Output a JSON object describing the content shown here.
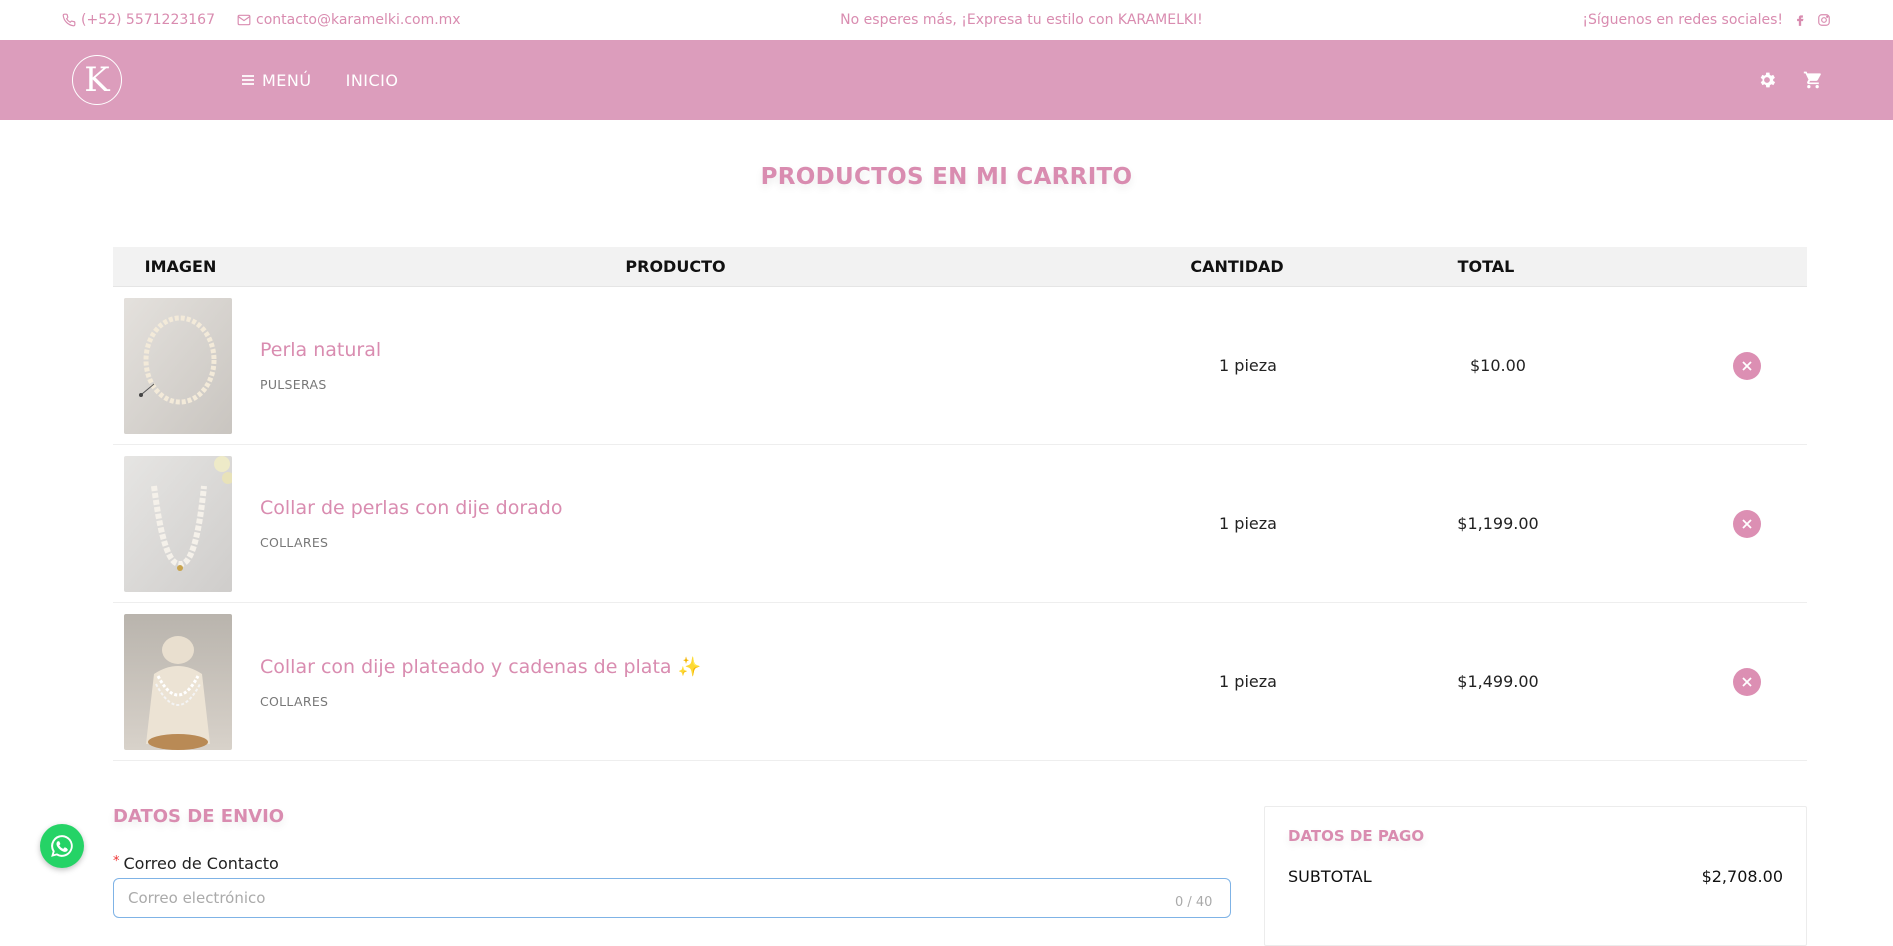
{
  "topbar": {
    "phone": "(+52) 5571223167",
    "email": "contacto@karamelki.com.mx",
    "promo": "No esperes más, ¡Expresa tu estilo con KARAMELKI!",
    "social": "¡Síguenos en redes sociales!"
  },
  "nav": {
    "logo_letter": "K",
    "menu_label": "MENÚ",
    "home_label": "INICIO"
  },
  "page_title": "PRODUCTOS EN MI CARRITO",
  "table": {
    "headers": {
      "image": "IMAGEN",
      "product": "PRODUCTO",
      "quantity": "CANTIDAD",
      "total": "TOTAL"
    },
    "rows": [
      {
        "name": "Perla natural",
        "category": "PULSERAS",
        "quantity": "1 pieza",
        "total": "$10.00"
      },
      {
        "name": "Collar de perlas con dije dorado",
        "category": "COLLARES",
        "quantity": "1 pieza",
        "total": "$1,199.00"
      },
      {
        "name": "Collar con dije plateado y cadenas de plata ✨",
        "category": "COLLARES",
        "quantity": "1 pieza",
        "total": "$1,499.00"
      }
    ]
  },
  "shipping": {
    "title": "DATOS DE ENVIO",
    "email_label": "Correo de Contacto",
    "email_placeholder": "Correo electrónico",
    "counter": "0 / 40"
  },
  "payment": {
    "title": "DATOS DE PAGO",
    "subtotal_label": "SUBTOTAL",
    "subtotal_value": "$2,708.00"
  },
  "colors": {
    "brand_pink": "#dc9dbc",
    "accent_text": "#d98cb0",
    "whatsapp": "#25d366"
  }
}
